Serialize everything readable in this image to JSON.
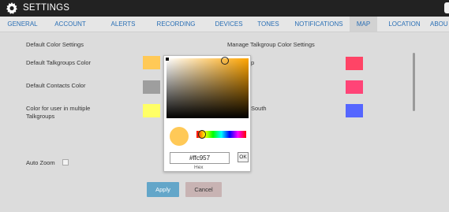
{
  "window": {
    "title": "SETTINGS"
  },
  "tabs": [
    {
      "label": "GENERAL"
    },
    {
      "label": "ACCOUNT"
    },
    {
      "label": "ALERTS"
    },
    {
      "label": "RECORDING"
    },
    {
      "label": "DEVICES"
    },
    {
      "label": "TONES"
    },
    {
      "label": "NOTIFICATIONS"
    },
    {
      "label": "MAP"
    },
    {
      "label": "LOCATION"
    },
    {
      "label": "ABOU"
    }
  ],
  "left_section": {
    "heading": "Default Color Settings",
    "talkgroups_label": "Default Talkgroups Color",
    "talkgroups_color": "#ffc957",
    "contacts_label": "Default Contacts Color",
    "contacts_color": "#9e9e9e",
    "multi_label_line1": "Color for user in multiple",
    "multi_label_line2": "Talkgroups",
    "multi_color": "#ffff66",
    "auto_zoom_label": "Auto Zoom"
  },
  "right_section": {
    "heading": "Manage Talkgroup Color Settings",
    "row1_partial": "p",
    "row1_color": "#ff4466",
    "row2_color": "#ff4477",
    "row3_partial": "South",
    "row3_color": "#5566ff"
  },
  "picker": {
    "hex_value": "#ffc957",
    "ok_label": "OK",
    "hex_caption": "Hex",
    "preview_color": "#ffc957"
  },
  "buttons": {
    "apply": "Apply",
    "cancel": "Cancel"
  }
}
